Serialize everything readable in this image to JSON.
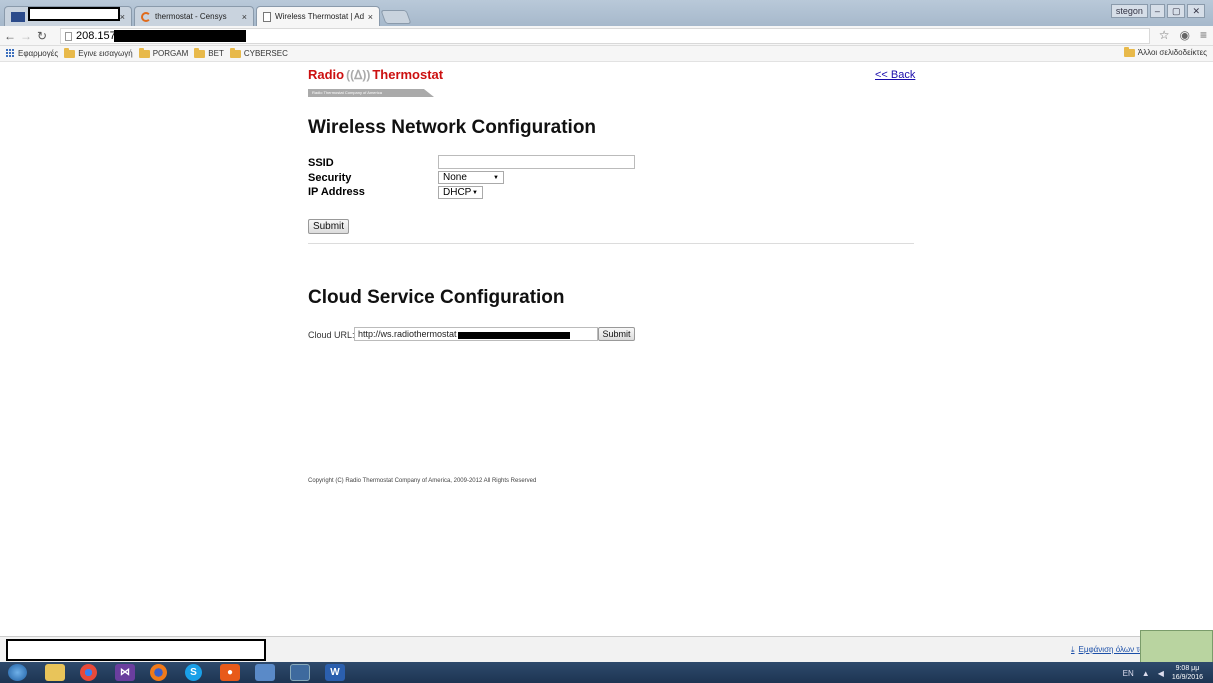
{
  "browser": {
    "tabs": [
      {
        "label": "",
        "active": false
      },
      {
        "label": "thermostat - Censys",
        "active": false
      },
      {
        "label": "Wireless Thermostat | Ad",
        "active": true
      }
    ],
    "tab_close_glyph": "×",
    "window_controls": [
      "stegon",
      "–",
      "▢",
      "✕"
    ],
    "url": "208.157",
    "bookmarks": [
      {
        "label": "Εφαρμογές",
        "icon": "apps-icon"
      },
      {
        "label": "Εγινε εισαγωγή",
        "icon": "folder-icon"
      },
      {
        "label": "PORGAM",
        "icon": "folder-icon"
      },
      {
        "label": "BET",
        "icon": "folder-icon"
      },
      {
        "label": "CYBERSEC",
        "icon": "folder-icon"
      }
    ],
    "other_bookmarks": "Άλλοι σελιδοδείκτες"
  },
  "header": {
    "logo_left": "Radio",
    "logo_right": "Thermostat",
    "logo_tagline": "Radio Thermostat Company of America",
    "back_link": "<< Back"
  },
  "wireless": {
    "title": "Wireless Network Configuration",
    "ssid_label": "SSID",
    "ssid_value": "",
    "security_label": "Security",
    "security_value": "None",
    "ip_label": "IP Address",
    "ip_value": "DHCP",
    "submit_label": "Submit"
  },
  "cloud": {
    "title": "Cloud Service Configuration",
    "url_label": "Cloud URL:",
    "url_value": "http://ws.radiothermostat",
    "submit_label": "Submit"
  },
  "footer": {
    "copyright": "Copyright (C) Radio Thermostat Company of America, 2009-2012 All Rights Reserved"
  },
  "downloads": {
    "show_all": "Εμφάνιση όλων των λήψεων..."
  },
  "taskbar": {
    "language": "EN",
    "time": "9:08 μμ",
    "date": "16/9/2016"
  },
  "colors": {
    "logo_red": "#cc1010",
    "link_blue": "#1a0dab",
    "taskbar": "#1d3452"
  }
}
